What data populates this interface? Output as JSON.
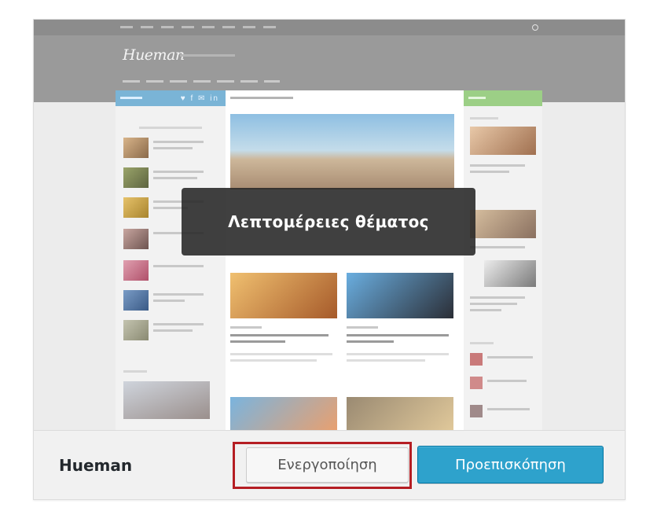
{
  "theme": {
    "name": "Hueman",
    "details_label": "Λεπτομέρειες θέματος",
    "activate_label": "Ενεργοποίηση",
    "preview_label": "Προεπισκόπηση"
  },
  "screenshot": {
    "logo_text": "Hueman",
    "social_icons": "♥ f ✉ in"
  },
  "colors": {
    "activate_highlight": "#b51e23",
    "preview_button": "#2ea2cc",
    "overlay": "#262626"
  }
}
